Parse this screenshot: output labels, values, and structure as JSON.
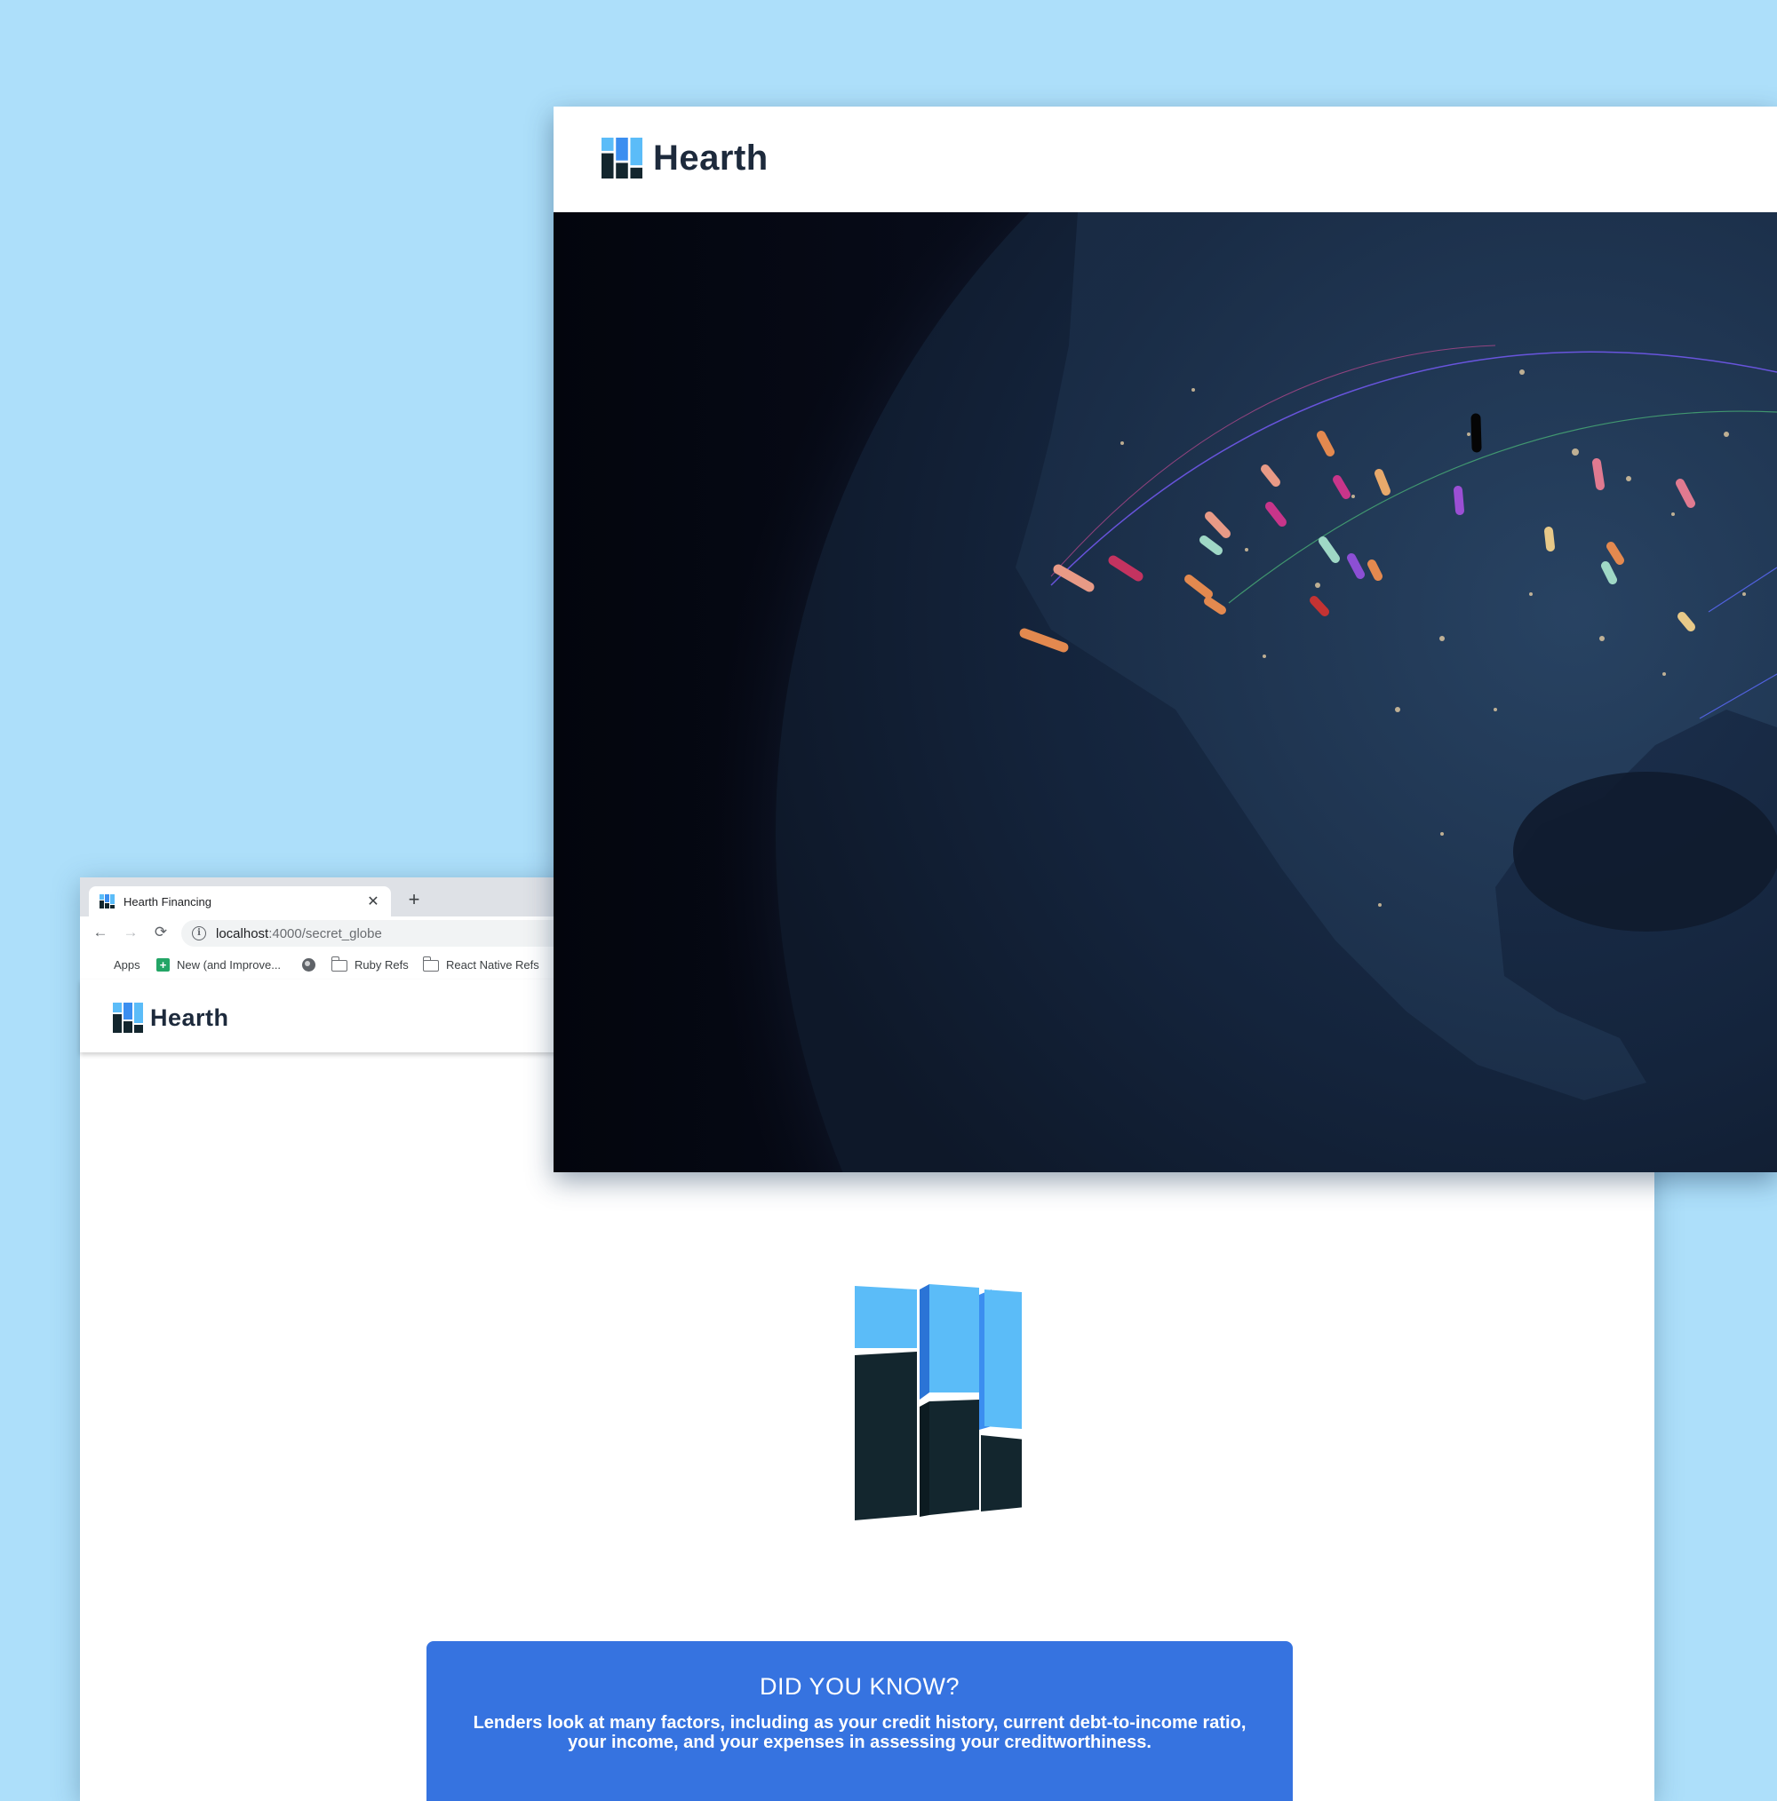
{
  "back_window": {
    "tab": {
      "title": "Hearth Financing"
    },
    "new_tab_symbol": "+",
    "nav": {
      "back_icon": "←",
      "forward_icon": "→",
      "reload_icon": "⟳"
    },
    "address_bar": {
      "host": "localhost",
      "path": ":4000/secret_globe"
    },
    "bookmarks": [
      {
        "label": "Apps",
        "icon": "apps-grid-icon"
      },
      {
        "label": "New (and Improve...",
        "icon": "google-sheets-icon"
      },
      {
        "label": "",
        "icon": "globe-icon"
      },
      {
        "label": "Ruby Refs",
        "icon": "folder-icon"
      },
      {
        "label": "React Native Refs",
        "icon": "folder-icon"
      }
    ],
    "header": {
      "brand": "Hearth"
    },
    "did_you_know": {
      "title": "DID YOU KNOW?",
      "text": "Lenders look at many factors, including as your credit history, current debt-to-income ratio, your income, and your expenses in assessing your creditworthiness."
    }
  },
  "front_window": {
    "header": {
      "brand": "Hearth"
    },
    "globe": {
      "view": "north-america-night"
    }
  },
  "colors": {
    "page_background": "#addffa",
    "brand_dark": "#1d2a3c",
    "logo_light_blue": "#5bbcf8",
    "logo_blue": "#3b8ef0",
    "logo_dark": "#13262e",
    "banner_blue": "#3673e0"
  }
}
